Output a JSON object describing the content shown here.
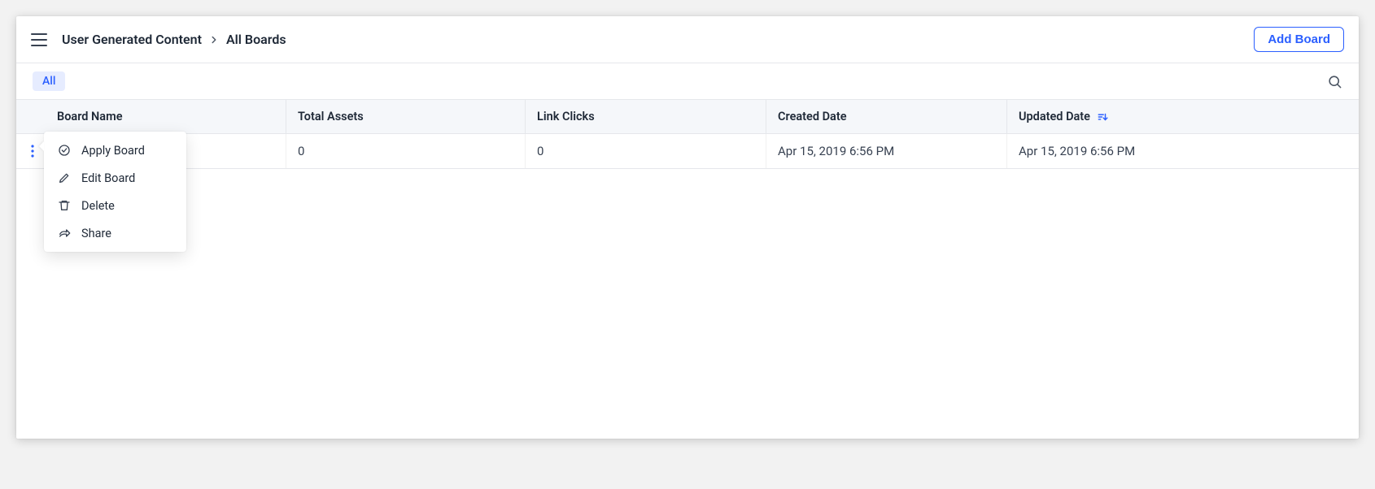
{
  "header": {
    "breadcrumb_parent": "User Generated Content",
    "breadcrumb_current": "All Boards",
    "add_button_label": "Add Board"
  },
  "filter": {
    "all_label": "All"
  },
  "columns": {
    "name": "Board Name",
    "assets": "Total Assets",
    "clicks": "Link Clicks",
    "created": "Created Date",
    "updated": "Updated Date"
  },
  "rows": [
    {
      "name": "",
      "assets": "0",
      "clicks": "0",
      "created": "Apr 15, 2019 6:56 PM",
      "updated": "Apr 15, 2019 6:56 PM"
    }
  ],
  "menu": {
    "apply": "Apply Board",
    "edit": "Edit Board",
    "delete": "Delete",
    "share": "Share"
  }
}
